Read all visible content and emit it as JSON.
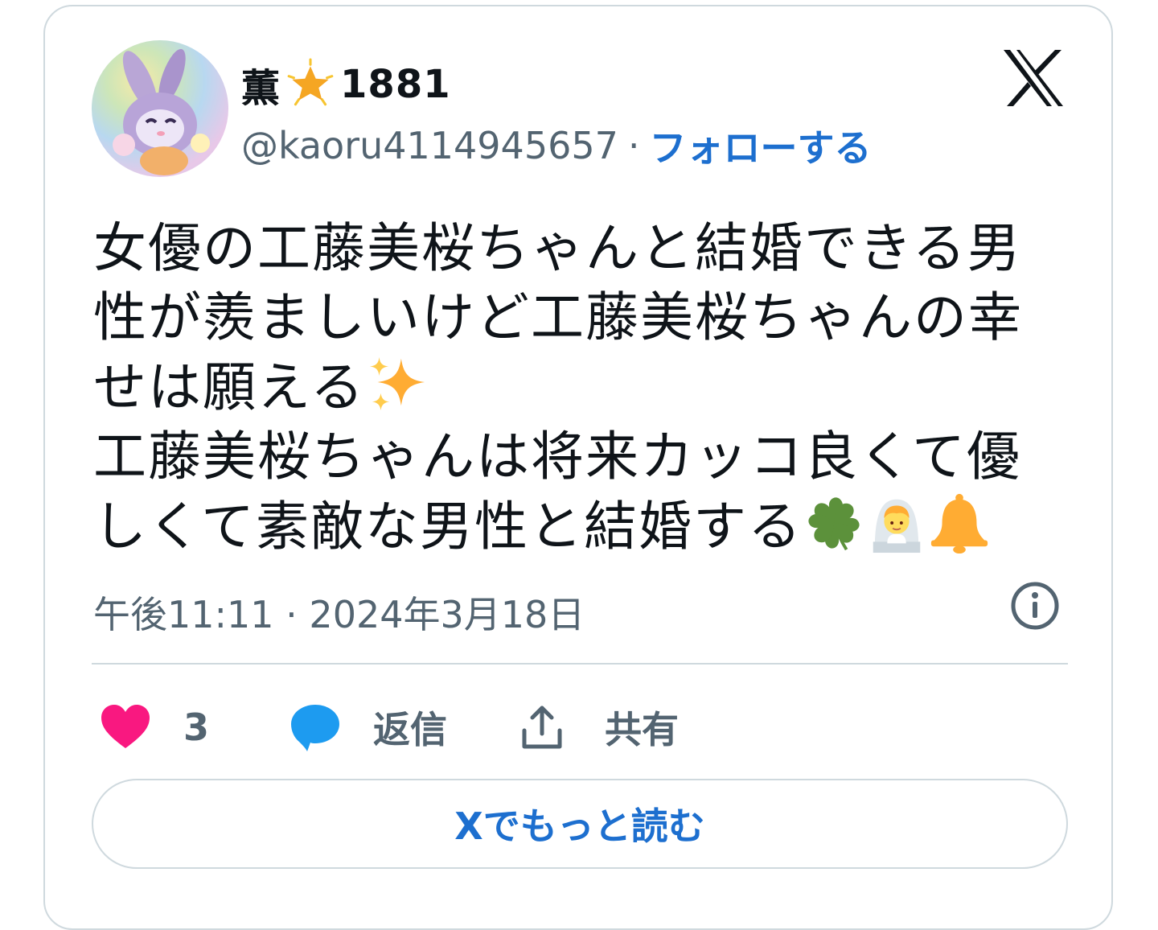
{
  "author": {
    "display_name": "薫",
    "display_name_suffix": "1881",
    "handle": "@kaoru4114945657",
    "separator": "·",
    "follow_label": "フォローする"
  },
  "tweet": {
    "lines": [
      "女優の工藤美桜ちゃんと結婚できる男",
      "性が羨ましいけど工藤美桜ちゃんの幸",
      "せは願える",
      "工藤美桜ちゃんは将来カッコ良くて優",
      "しくて素敵な男性と結婚する"
    ],
    "timestamp": "午後11:11 · 2024年3月18日"
  },
  "actions": {
    "like_count": "3",
    "reply_label": "返信",
    "share_label": "共有"
  },
  "read_more_label": "Xでもっと読む",
  "colors": {
    "accent": "#1d6fcf",
    "muted": "#536471",
    "heart": "#f91880",
    "reply": "#1d9bf0",
    "border": "#cfd9de"
  },
  "icons": [
    "star-icon",
    "x-logo-icon",
    "sparkles-icon",
    "four-leaf-clover-icon",
    "person-with-veil-icon",
    "bell-icon",
    "info-icon",
    "heart-icon",
    "speech-bubble-icon",
    "share-icon"
  ]
}
